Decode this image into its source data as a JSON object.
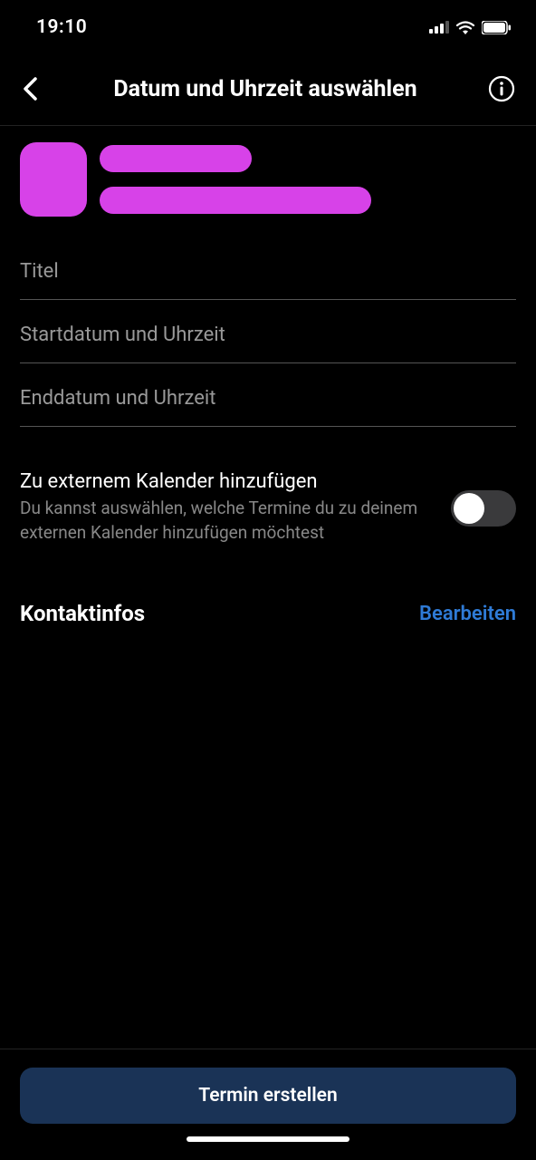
{
  "statusBar": {
    "time": "19:10"
  },
  "header": {
    "title": "Datum und Uhrzeit auswählen"
  },
  "fields": {
    "titleLabel": "Titel",
    "startLabel": "Startdatum und Uhrzeit",
    "endLabel": "Enddatum und Uhrzeit"
  },
  "calendarToggle": {
    "title": "Zu externem Kalender hinzufügen",
    "description": "Du kannst auswählen, welche Termine du zu deinem externen Kalender hinzufügen möchtest",
    "enabled": false
  },
  "contactSection": {
    "title": "Kontaktinfos",
    "editLabel": "Bearbeiten"
  },
  "footer": {
    "createButton": "Termin erstellen"
  }
}
